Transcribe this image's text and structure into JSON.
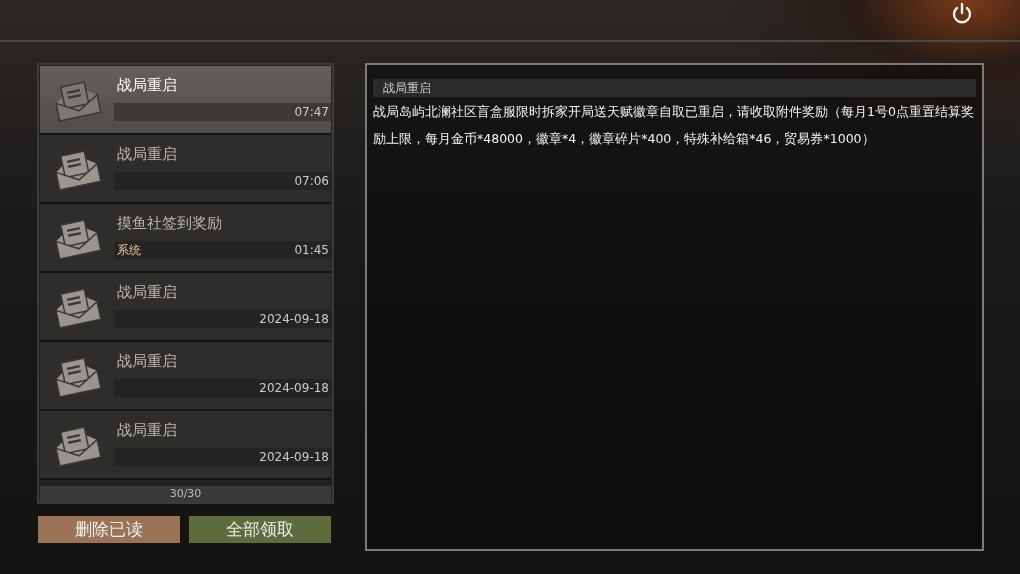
{
  "mails": [
    {
      "title": "战局重启",
      "time": "07:47",
      "selected": true
    },
    {
      "title": "战局重启",
      "time": "07:06",
      "selected": false
    },
    {
      "title": "摸鱼社签到奖励",
      "sender": "系统",
      "time": "01:45",
      "selected": false
    },
    {
      "title": "战局重启",
      "time": "2024-09-18",
      "selected": false
    },
    {
      "title": "战局重启",
      "time": "2024-09-18",
      "selected": false
    },
    {
      "title": "战局重启",
      "time": "2024-09-18",
      "selected": false
    }
  ],
  "count": "30/30",
  "buttons": [
    {
      "label": "删除已读",
      "kind": "delete"
    },
    {
      "label": "全部领取",
      "kind": "claim"
    }
  ],
  "detail": {
    "title": "战局重启",
    "body": "战局岛屿北澜社区盲盒服限时拆家开局送天赋徽章自取已重启，请收取附件奖励（每月1号0点重置结算奖励上限，每月金币*48000，徽章*4，徽章碎片*400，特殊补给箱*46，贸易券*1000）"
  }
}
